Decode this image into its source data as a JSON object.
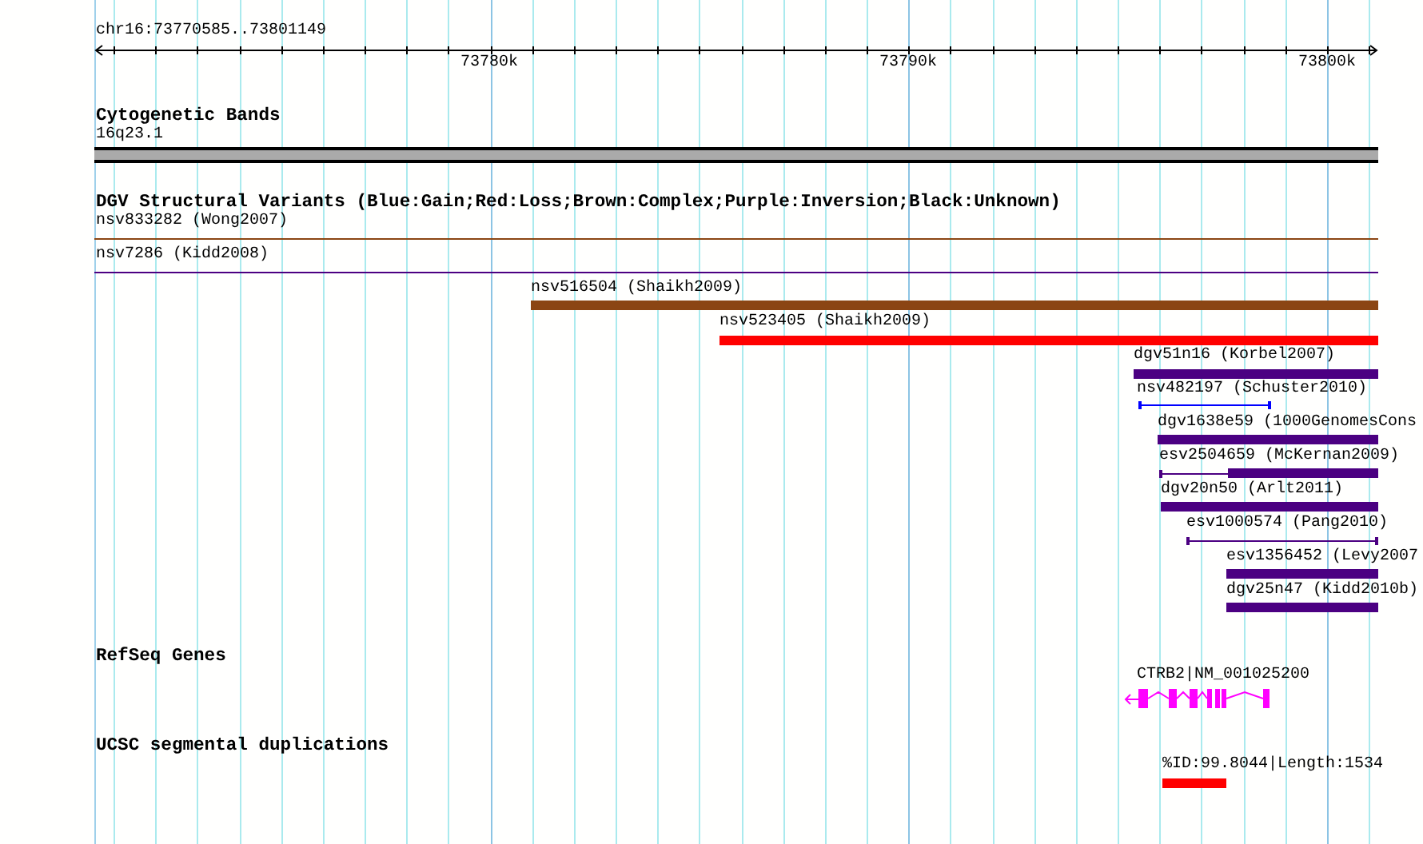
{
  "ruler": {
    "label": "chr16:73770585..73801149",
    "ticks": [
      "73780k",
      "73790k",
      "73800k"
    ]
  },
  "tracks": [
    {
      "title": "Cytogenetic Bands",
      "features": [
        {
          "kind": "band",
          "label": "16q23.1",
          "color": "#aaaaaa"
        }
      ]
    },
    {
      "title": "DGV Structural Variants (Blue:Gain;Red:Loss;Brown:Complex;Purple:Inversion;Black:Unknown)",
      "features": [
        {
          "kind": "line",
          "label": "nsv833282 (Wong2007)",
          "color": "#8b4513"
        },
        {
          "kind": "line",
          "label": "nsv7286 (Kidd2008)",
          "color": "#4b0082"
        },
        {
          "kind": "bar",
          "label": "nsv516504 (Shaikh2009)",
          "color": "#8b4513"
        },
        {
          "kind": "bar",
          "label": "nsv523405 (Shaikh2009)",
          "color": "#ff0000"
        },
        {
          "kind": "bar",
          "label": "dgv51n16 (Korbel2007)",
          "color": "#4b0082"
        },
        {
          "kind": "span",
          "label": "nsv482197 (Schuster2010)",
          "color": "#0000ff"
        },
        {
          "kind": "bar",
          "label": "dgv1638e59 (1000GenomesCons",
          "color": "#4b0082"
        },
        {
          "kind": "split",
          "label": "esv2504659 (McKernan2009)",
          "color": "#4b0082"
        },
        {
          "kind": "bar",
          "label": "dgv20n50 (Arlt2011)",
          "color": "#4b0082"
        },
        {
          "kind": "span",
          "label": "esv1000574 (Pang2010)",
          "color": "#4b0082"
        },
        {
          "kind": "bar",
          "label": "esv1356452 (Levy2007",
          "color": "#4b0082"
        },
        {
          "kind": "bar",
          "label": "dgv25n47 (Kidd2010b)",
          "color": "#4b0082"
        }
      ]
    },
    {
      "title": "RefSeq Genes",
      "features": [
        {
          "kind": "gene",
          "label": "CTRB2|NM_001025200",
          "color": "#ff00ff"
        }
      ]
    },
    {
      "title": "UCSC segmental duplications",
      "features": [
        {
          "kind": "bar",
          "label": "%ID:99.8044|Length:1534",
          "color": "#ff0000"
        }
      ]
    }
  ]
}
